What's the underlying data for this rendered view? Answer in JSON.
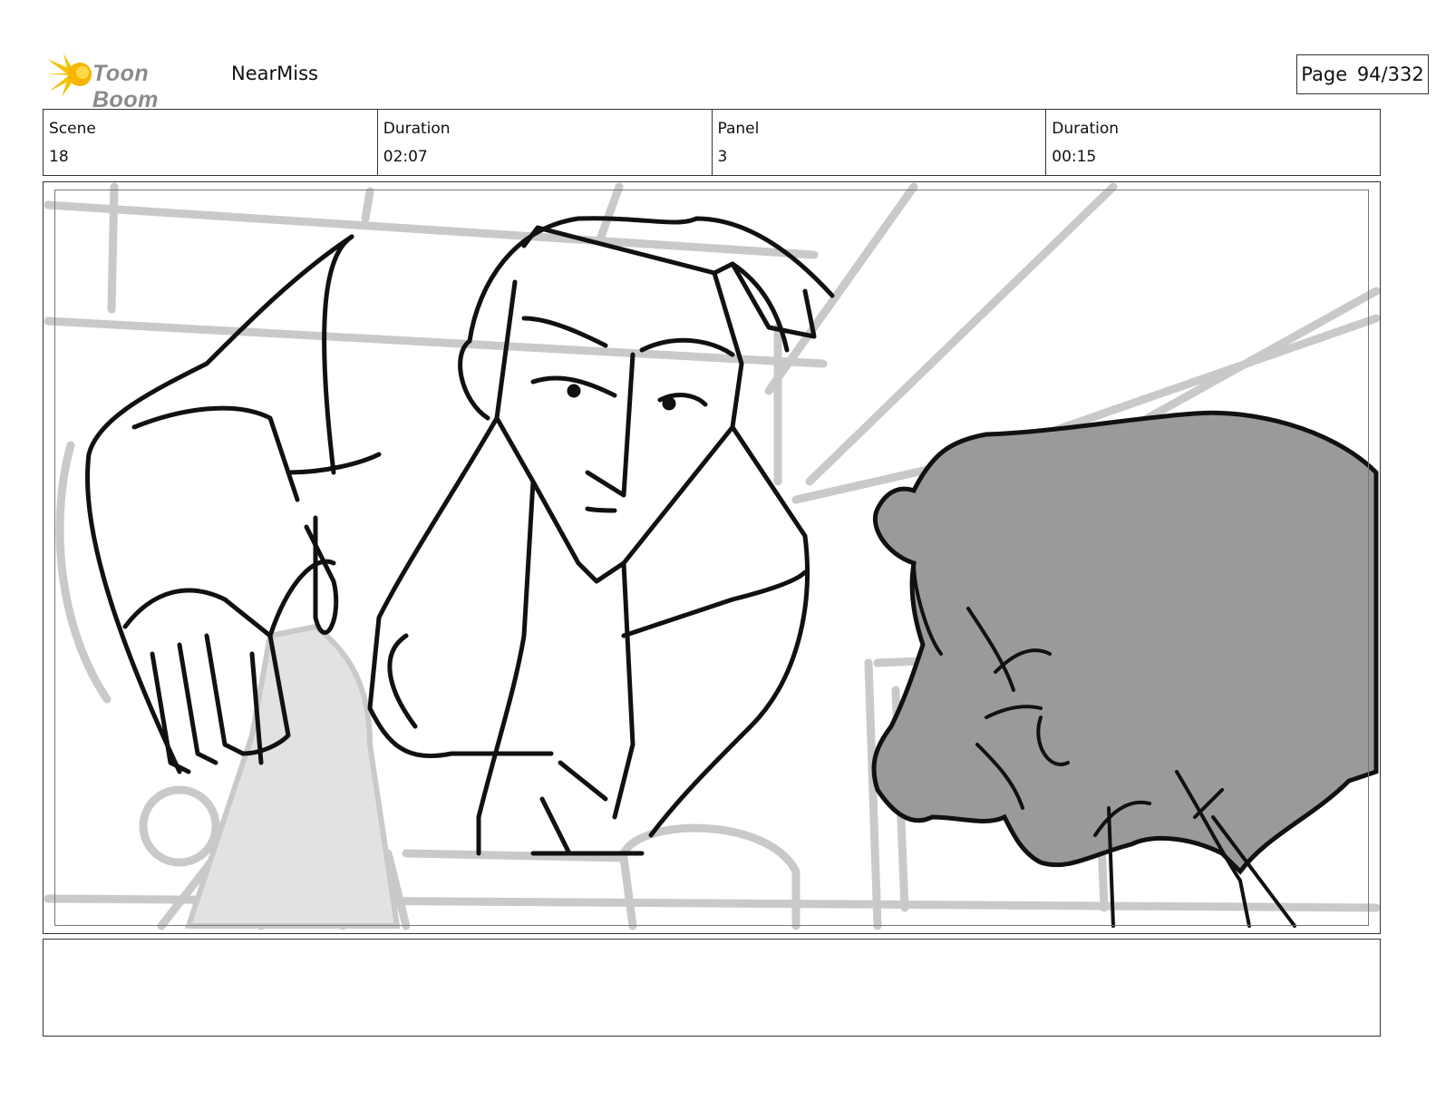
{
  "header": {
    "logo_text": "Toon Boom",
    "project_name": "NearMiss",
    "page_label": "Page",
    "page_value": "94/332"
  },
  "info": {
    "scene_label": "Scene",
    "scene_value": "18",
    "scene_duration_label": "Duration",
    "scene_duration_value": "02:07",
    "panel_label": "Panel",
    "panel_value": "3",
    "panel_duration_label": "Duration",
    "panel_duration_value": "00:15"
  },
  "notes": {
    "text": ""
  }
}
